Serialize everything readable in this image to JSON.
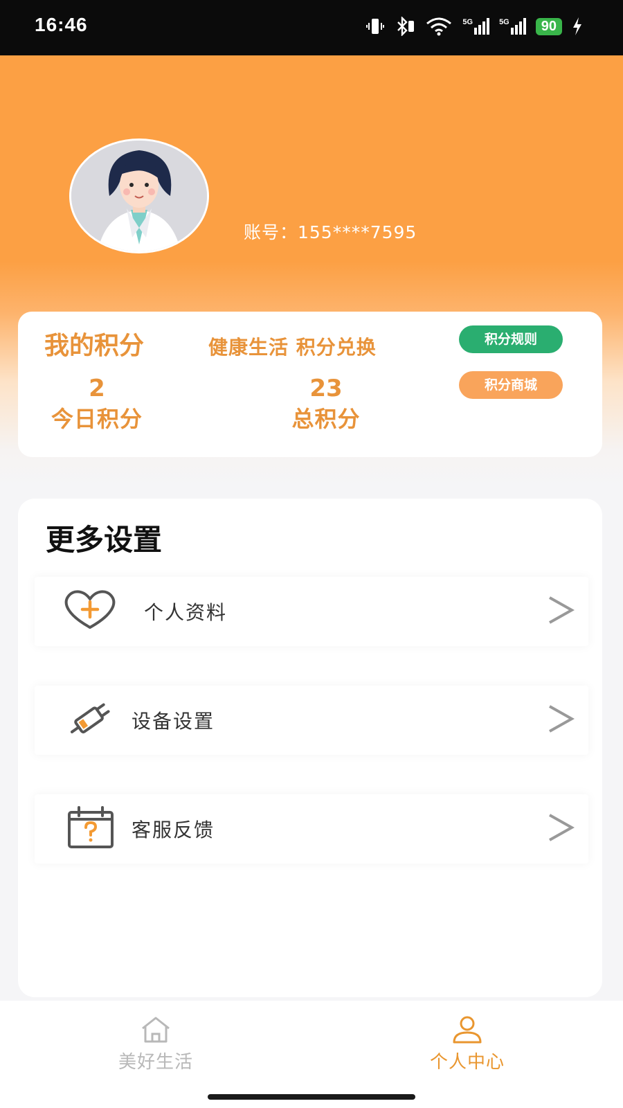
{
  "status_bar": {
    "time": "16:46",
    "network_1": "5G",
    "network_2": "5G",
    "battery": "90"
  },
  "profile": {
    "account_text": "账号：155****7595"
  },
  "points": {
    "title": "我的积分",
    "slogan": "健康生活  积分兑换",
    "rules_button": "积分规则",
    "mall_button": "积分商城",
    "today_value": "2",
    "today_label": "今日积分",
    "total_value": "23",
    "total_label": "总积分"
  },
  "settings": {
    "title": "更多设置",
    "items": [
      {
        "label": "个人资料",
        "icon": "heart-plus-icon"
      },
      {
        "label": "设备设置",
        "icon": "device-plug-icon"
      },
      {
        "label": "客服反馈",
        "icon": "calendar-question-icon"
      }
    ]
  },
  "tab_bar": {
    "home_label": "美好生活",
    "me_label": "个人中心",
    "active_color": "#e9962f",
    "inactive_color": "#b8b8b8"
  },
  "colors": {
    "accent": "#fca044",
    "points_text": "#e8933a",
    "green_pill": "#2aae70",
    "orange_pill": "#f9a45b"
  }
}
